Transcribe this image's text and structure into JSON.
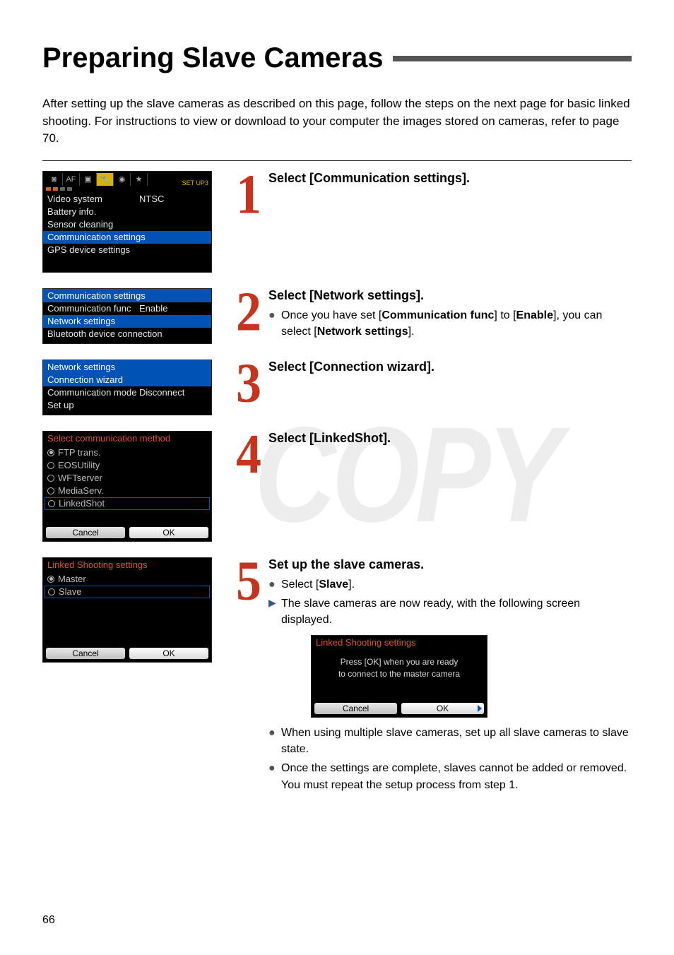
{
  "page_number": "66",
  "title": "Preparing Slave Cameras",
  "intro": "After setting up the slave cameras as described on this page, follow the steps on the next page for basic linked shooting. For instructions to view or download to your computer the images stored on cameras, refer to page 70.",
  "watermark": "COPY",
  "step1": {
    "num": "1",
    "heading": "Select [Communication settings].",
    "cam": {
      "setup_label": "SET UP3",
      "tab_labels": [
        "📷",
        "AF",
        "▸",
        "🔧",
        "🔧",
        "★"
      ],
      "rows": [
        {
          "left": "Video system",
          "right": "NTSC"
        },
        {
          "left": "Battery info.",
          "right": ""
        },
        {
          "left": "Sensor cleaning",
          "right": ""
        },
        {
          "left": "Communication settings",
          "right": "",
          "hl": true
        },
        {
          "left": "GPS device settings",
          "right": ""
        }
      ]
    }
  },
  "step2": {
    "num": "2",
    "heading": "Select [Network settings].",
    "bullet1_a": "Once you have set [",
    "bullet1_b": "Communication func",
    "bullet1_c": "] to [",
    "bullet1_d": "Enable",
    "bullet1_e": "], you can select [",
    "bullet1_f": "Network settings",
    "bullet1_g": "].",
    "cam": {
      "header": "Communication settings",
      "rows": [
        {
          "left": "Communication func",
          "right": "Enable"
        },
        {
          "left": "Network settings",
          "right": "",
          "hl": true
        },
        {
          "left": "Bluetooth device connection",
          "right": ""
        }
      ]
    }
  },
  "step3": {
    "num": "3",
    "heading": "Select [Connection wizard].",
    "cam": {
      "header": "Network settings",
      "rows": [
        {
          "left": "Connection wizard",
          "right": "",
          "hl": true
        },
        {
          "left": "Communication mode",
          "right": "Disconnect"
        },
        {
          "left": "Set up",
          "right": ""
        }
      ]
    }
  },
  "step4": {
    "num": "4",
    "heading": "Select [LinkedShot].",
    "cam": {
      "header": "Select communication method",
      "options": [
        {
          "label": "FTP trans.",
          "sel": true
        },
        {
          "label": "EOSUtility"
        },
        {
          "label": "WFTserver"
        },
        {
          "label": "MediaServ."
        },
        {
          "label": "LinkedShot",
          "border": true
        }
      ],
      "cancel": "Cancel",
      "ok": "OK"
    }
  },
  "step5": {
    "num": "5",
    "heading": "Set up the slave cameras.",
    "b1_a": "Select [",
    "b1_b": "Slave",
    "b1_c": "].",
    "b2": "The slave cameras are now ready, with the following screen displayed.",
    "cam": {
      "header": "Linked Shooting settings",
      "options": [
        {
          "label": "Master",
          "sel": true
        },
        {
          "label": "Slave",
          "border": true
        }
      ],
      "cancel": "Cancel",
      "ok": "OK"
    },
    "inset": {
      "header": "Linked Shooting settings",
      "line1": "Press [OK] when you are ready",
      "line2": "to connect to the master camera",
      "cancel": "Cancel",
      "ok": "OK"
    },
    "b3": "When using multiple slave cameras, set up all slave cameras to slave state.",
    "b4": "Once the settings are complete, slaves cannot be added or removed. You must repeat the setup process from step 1."
  }
}
